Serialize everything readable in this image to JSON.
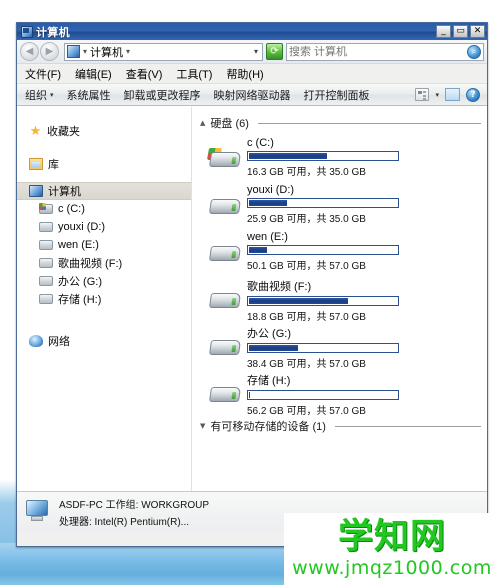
{
  "window": {
    "title": "计算机",
    "icon": "computer-icon",
    "controls": {
      "minimize": "_",
      "maximize": "▭",
      "close": "✕"
    }
  },
  "address": {
    "back": "◀",
    "forward": "▶",
    "icon": "computer-icon",
    "crumbs": [
      "计算机"
    ],
    "separator": "▾",
    "dropdown": "▾",
    "refresh": "⟳"
  },
  "search": {
    "placeholder": "搜索 计算机",
    "value": "",
    "icon": "search-icon"
  },
  "menubar": {
    "items": [
      {
        "label": "文件(F)"
      },
      {
        "label": "编辑(E)"
      },
      {
        "label": "查看(V)"
      },
      {
        "label": "工具(T)"
      },
      {
        "label": "帮助(H)"
      }
    ]
  },
  "commandbar": {
    "items": [
      {
        "label": "组织",
        "caret": "▾"
      },
      {
        "label": "系统属性"
      },
      {
        "label": "卸载或更改程序"
      },
      {
        "label": "映射网络驱动器"
      },
      {
        "label": "打开控制面板"
      }
    ],
    "view_caret": "▾",
    "help_label": "?"
  },
  "sidebar": {
    "groups": [
      {
        "label": "收藏夹",
        "icon": "star-icon"
      },
      {
        "label": "库",
        "icon": "library-icon"
      }
    ],
    "computer": {
      "label": "计算机",
      "icon": "computer-icon",
      "selected": true
    },
    "drives": [
      {
        "label": "c (C:)",
        "icon": "system-drive-icon"
      },
      {
        "label": "youxi (D:)",
        "icon": "drive-icon"
      },
      {
        "label": "wen (E:)",
        "icon": "drive-icon"
      },
      {
        "label": "歌曲视频 (F:)",
        "icon": "drive-icon"
      },
      {
        "label": "办公 (G:)",
        "icon": "drive-icon"
      },
      {
        "label": "存储 (H:)",
        "icon": "drive-icon"
      }
    ],
    "network": {
      "label": "网络",
      "icon": "network-icon"
    }
  },
  "content": {
    "groups": [
      {
        "label": "硬盘 (6)",
        "triangle": "▲",
        "expanded": true,
        "drives": [
          {
            "name": "c (C:)",
            "free_text": "16.3 GB 可用，共 35.0 GB",
            "free_gb": 16.3,
            "total_gb": 35.0,
            "used_percent": 53,
            "icon": "system-drive-icon"
          },
          {
            "name": "youxi (D:)",
            "free_text": "25.9 GB 可用，共 35.0 GB",
            "free_gb": 25.9,
            "total_gb": 35.0,
            "used_percent": 26,
            "icon": "drive-icon"
          },
          {
            "name": "wen (E:)",
            "free_text": "50.1 GB 可用，共 57.0 GB",
            "free_gb": 50.1,
            "total_gb": 57.0,
            "used_percent": 12,
            "icon": "drive-icon"
          },
          {
            "name": "歌曲视频 (F:)",
            "free_text": "18.8 GB 可用，共 57.0 GB",
            "free_gb": 18.8,
            "total_gb": 57.0,
            "used_percent": 67,
            "icon": "drive-icon"
          },
          {
            "name": "办公 (G:)",
            "free_text": "38.4 GB 可用，共 57.0 GB",
            "free_gb": 38.4,
            "total_gb": 57.0,
            "used_percent": 33,
            "icon": "drive-icon"
          },
          {
            "name": "存储 (H:)",
            "free_text": "56.2 GB 可用，共 57.0 GB",
            "free_gb": 56.2,
            "total_gb": 57.0,
            "used_percent": 1,
            "icon": "drive-icon"
          }
        ]
      },
      {
        "label": "有可移动存储的设备 (1)",
        "triangle": "▼",
        "expanded": false,
        "drives": []
      }
    ]
  },
  "statusbar": {
    "icon": "computer-icon",
    "line1": "ASDF-PC 工作组: WORKGROUP",
    "line2": "处理器: Intel(R) Pentium(R)..."
  },
  "watermark": {
    "top": "学知网",
    "bottom": "www.jmqz1000.com",
    "color": "#22c722"
  }
}
